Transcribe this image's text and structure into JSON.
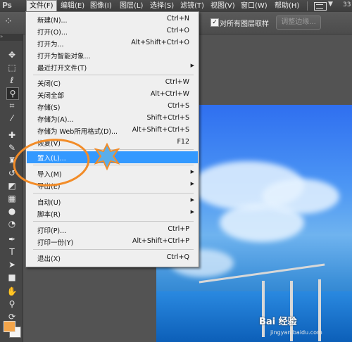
{
  "app": {
    "logo": "Ps"
  },
  "menubar": {
    "items": [
      "文件(F)",
      "编辑(E)",
      "图像(I)",
      "图层(L)",
      "选择(S)",
      "滤镜(T)",
      "视图(V)",
      "窗口(W)",
      "帮助(H)"
    ],
    "zoom_partial": "33"
  },
  "options": {
    "sample_all_layers_label": "对所有图层取样",
    "sample_all_layers_checked": true,
    "refine_edge_label": "调整边缘..."
  },
  "file_menu": {
    "items": [
      {
        "label": "新建(N)...",
        "shortcut": "Ctrl+N"
      },
      {
        "label": "打开(O)...",
        "shortcut": "Ctrl+O"
      },
      {
        "label": "打开为...",
        "shortcut": "Alt+Shift+Ctrl+O"
      },
      {
        "label": "打开为智能对象...",
        "shortcut": ""
      },
      {
        "label": "最近打开文件(T)",
        "shortcut": "",
        "submenu": true
      },
      {
        "label": "关闭(C)",
        "shortcut": "Ctrl+W"
      },
      {
        "label": "关闭全部",
        "shortcut": "Alt+Ctrl+W"
      },
      {
        "label": "存储(S)",
        "shortcut": "Ctrl+S"
      },
      {
        "label": "存储为(A)...",
        "shortcut": "Shift+Ctrl+S"
      },
      {
        "label": "存储为 Web所用格式(D)...",
        "shortcut": "Alt+Shift+Ctrl+S"
      },
      {
        "label": "恢复(V)",
        "shortcut": "F12"
      },
      {
        "label": "置入(L)...",
        "shortcut": "",
        "highlighted": true
      },
      {
        "label": "导入(M)",
        "shortcut": "",
        "submenu": true
      },
      {
        "label": "导出(E)",
        "shortcut": "",
        "submenu": true
      },
      {
        "label": "自动(U)",
        "shortcut": "",
        "submenu": true
      },
      {
        "label": "脚本(R)",
        "shortcut": "",
        "submenu": true
      },
      {
        "label": "打印(P)...",
        "shortcut": "Ctrl+P"
      },
      {
        "label": "打印一份(Y)",
        "shortcut": "Alt+Shift+Ctrl+P"
      },
      {
        "label": "退出(X)",
        "shortcut": "Ctrl+Q"
      }
    ]
  },
  "colors": {
    "foreground": "#f4a54a",
    "background": "#f5f5f5",
    "highlight": "#3399ff",
    "annotation": "#f28c28"
  },
  "watermark": {
    "text": "Bai 经验",
    "sub": "jingyan.baidu.com"
  }
}
